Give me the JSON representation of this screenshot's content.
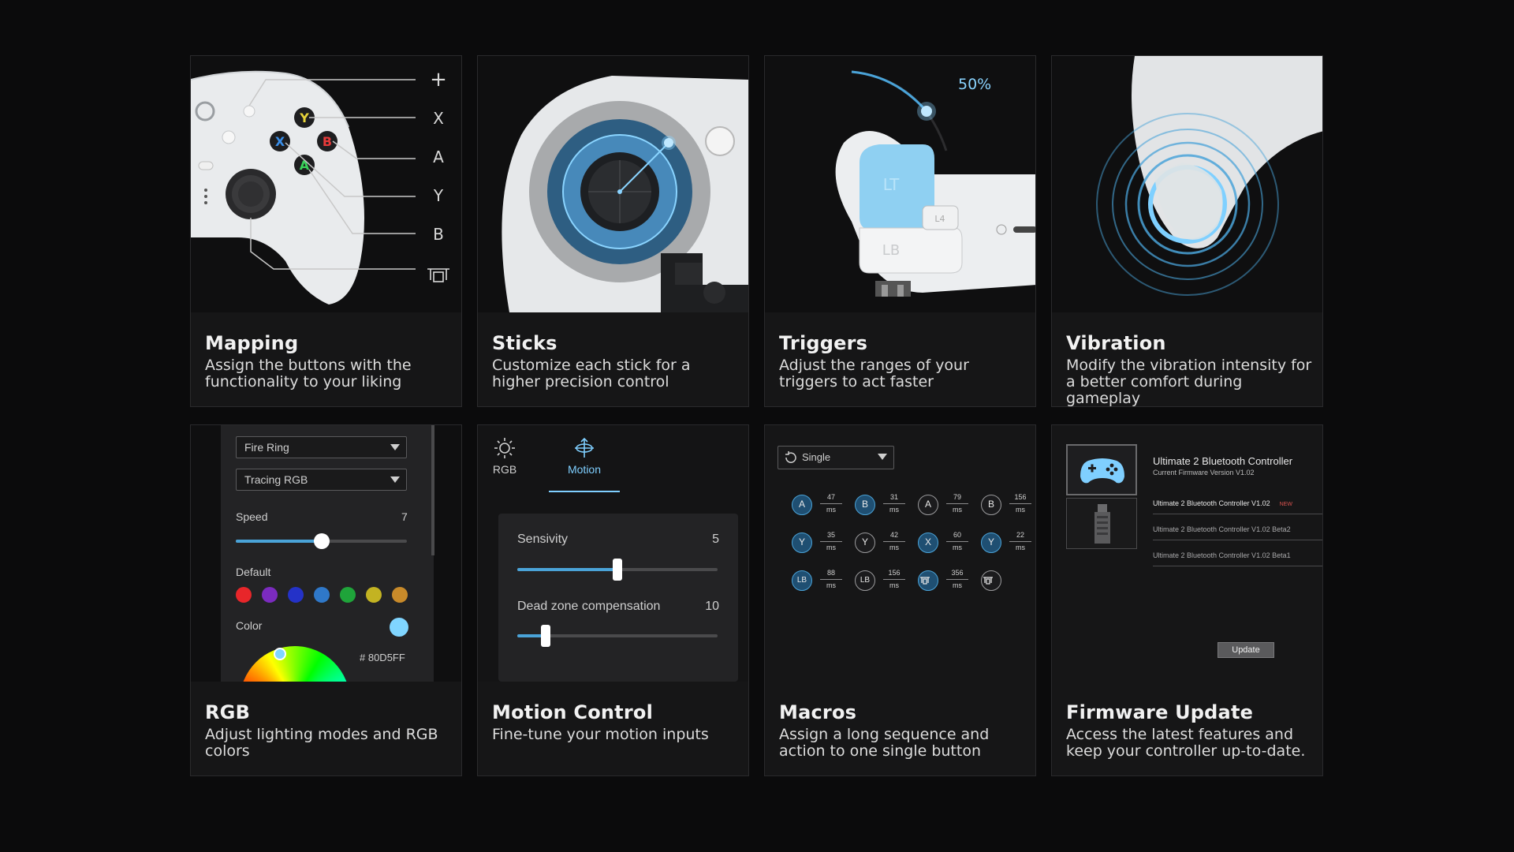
{
  "cards": {
    "mapping": {
      "title": "Mapping",
      "desc": "Assign the buttons with the functionality to your liking",
      "labels": [
        "+",
        "X",
        "A",
        "Y",
        "B"
      ]
    },
    "sticks": {
      "title": "Sticks",
      "desc": "Customize each stick for a higher precision control"
    },
    "triggers": {
      "title": "Triggers",
      "desc": "Adjust the ranges of your triggers to act faster",
      "percent": "50%",
      "lt_label": "LT",
      "lb_label": "LB",
      "l4_label": "L4"
    },
    "vibration": {
      "title": "Vibration",
      "desc": "Modify the vibration intensity for a better comfort during gameplay"
    },
    "rgb": {
      "title": "RGB",
      "desc": "Adjust lighting modes and RGB colors",
      "mode_select": "Fire Ring",
      "effect_select": "Tracing RGB",
      "speed_label": "Speed",
      "speed_value": "7",
      "speed_fraction": 0.5,
      "default_label": "Default",
      "color_label": "Color",
      "hex": "# 80D5FF",
      "swatches": [
        "#e8262a",
        "#7b2bbf",
        "#2432c8",
        "#2f78c9",
        "#1fa43a",
        "#c3b322",
        "#c88a2a"
      ],
      "selected_color": "#80D5FF"
    },
    "motion": {
      "title": "Motion Control",
      "desc": "Fine-tune your motion inputs",
      "tabs": [
        "RGB",
        "Motion"
      ],
      "sensitivity_label": "Sensivity",
      "sensitivity_value": "5",
      "sensitivity_fraction": 0.5,
      "deadzone_label": "Dead zone compensation",
      "deadzone_value": "10",
      "deadzone_fraction": 0.14
    },
    "macros": {
      "title": "Macros",
      "desc": "Assign a long sequence and action to one single button",
      "mode_select": "Single",
      "unit": "ms",
      "rows": [
        [
          {
            "b": "A",
            "t": "47",
            "hl": true
          },
          {
            "b": "B",
            "t": "31",
            "hl": true
          },
          {
            "b": "A",
            "t": "79",
            "hl": false
          },
          {
            "b": "B",
            "t": "156",
            "hl": false
          }
        ],
        [
          {
            "b": "Y",
            "t": "35",
            "hl": true
          },
          {
            "b": "Y",
            "t": "42",
            "hl": false
          },
          {
            "b": "X",
            "t": "60",
            "hl": true
          },
          {
            "b": "Y",
            "t": "22",
            "hl": true
          }
        ],
        [
          {
            "b": "LB",
            "t": "88",
            "hl": true
          },
          {
            "b": "LB",
            "t": "156",
            "hl": false
          },
          {
            "b": "",
            "t": "356",
            "hl": true
          },
          {
            "b": "",
            "t": "",
            "hl": false
          }
        ]
      ]
    },
    "firmware": {
      "title": "Firmware Update",
      "desc": "Access the latest features and keep your controller up-to-date.",
      "device_name": "Ultimate 2 Bluetooth Controller",
      "current_version": "Current Firmware Version V1.02",
      "versions": [
        {
          "name": "Ultimate 2 Bluetooth Controller V1.02",
          "badge": "NEW"
        },
        {
          "name": "Ultimate 2 Bluetooth Controller V1.02 Beta2",
          "badge": ""
        },
        {
          "name": "Ultimate 2 Bluetooth Controller V1.02 Beta1",
          "badge": ""
        }
      ],
      "update_button": "Update"
    }
  },
  "colors": {
    "accent": "#4aa3d8",
    "card_bg": "#161617",
    "page_bg": "#0b0b0c"
  }
}
